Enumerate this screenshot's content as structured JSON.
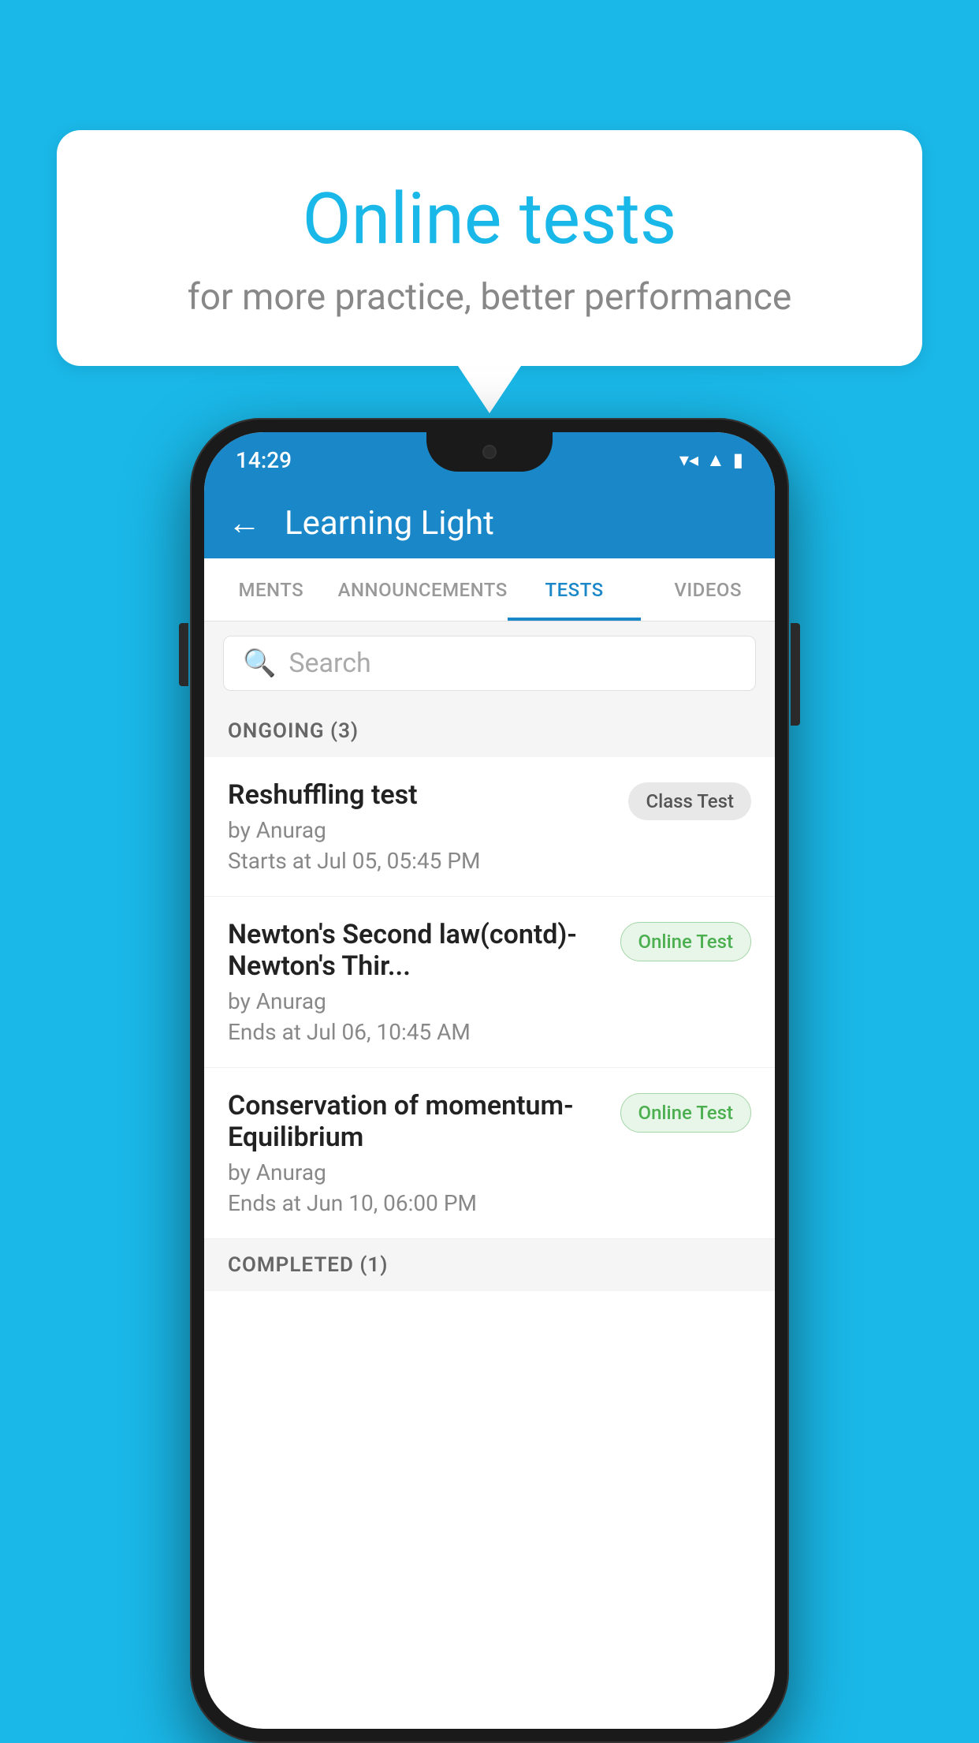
{
  "background_color": "#1ab8e8",
  "speech_bubble": {
    "title": "Online tests",
    "subtitle": "for more practice, better performance"
  },
  "phone": {
    "status_bar": {
      "time": "14:29",
      "icons": [
        "wifi",
        "signal",
        "battery"
      ]
    },
    "app_header": {
      "back_label": "←",
      "title": "Learning Light"
    },
    "tabs": [
      {
        "label": "MENTS",
        "active": false
      },
      {
        "label": "ANNOUNCEMENTS",
        "active": false
      },
      {
        "label": "TESTS",
        "active": true
      },
      {
        "label": "VIDEOS",
        "active": false
      }
    ],
    "search": {
      "placeholder": "Search"
    },
    "sections": [
      {
        "header": "ONGOING (3)",
        "tests": [
          {
            "name": "Reshuffling test",
            "author": "by Anurag",
            "time_label": "Starts at",
            "time": "Jul 05, 05:45 PM",
            "badge": "Class Test",
            "badge_type": "class"
          },
          {
            "name": "Newton's Second law(contd)-Newton's Thir...",
            "author": "by Anurag",
            "time_label": "Ends at",
            "time": "Jul 06, 10:45 AM",
            "badge": "Online Test",
            "badge_type": "online"
          },
          {
            "name": "Conservation of momentum-Equilibrium",
            "author": "by Anurag",
            "time_label": "Ends at",
            "time": "Jun 10, 06:00 PM",
            "badge": "Online Test",
            "badge_type": "online"
          }
        ]
      }
    ],
    "completed_header": "COMPLETED (1)"
  }
}
